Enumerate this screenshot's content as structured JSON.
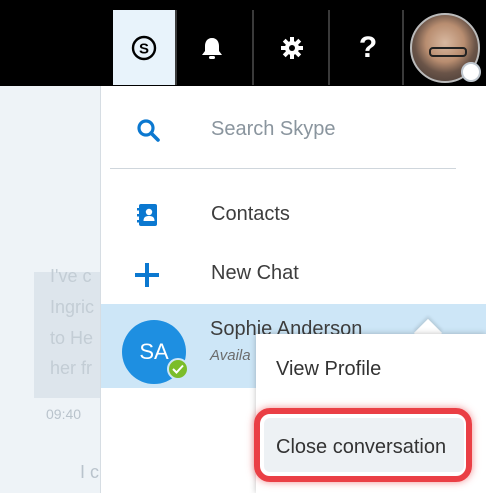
{
  "topbar": {
    "skype_icon": "skype-s-icon",
    "bell_icon": "bell-icon",
    "gear_icon": "gear-icon",
    "help_label": "?",
    "avatar_icon": "profile-avatar"
  },
  "background": {
    "lines": [
      "I've c",
      "Ingric",
      "to He",
      "her fr"
    ],
    "time": "09:40",
    "bottom_text": "I c"
  },
  "menu": {
    "search_label": "Search Skype",
    "contacts_label": "Contacts",
    "new_chat_label": "New Chat"
  },
  "contact": {
    "initials": "SA",
    "name": "Sophie Anderson",
    "status": "Availa"
  },
  "context_menu": {
    "view_profile": "View Profile",
    "close_conversation": "Close conversation"
  },
  "colors": {
    "accent": "#0b78d0",
    "selected_row": "#cde6f7",
    "highlight": "#ea3f45",
    "status_available": "#7bbd2a"
  }
}
